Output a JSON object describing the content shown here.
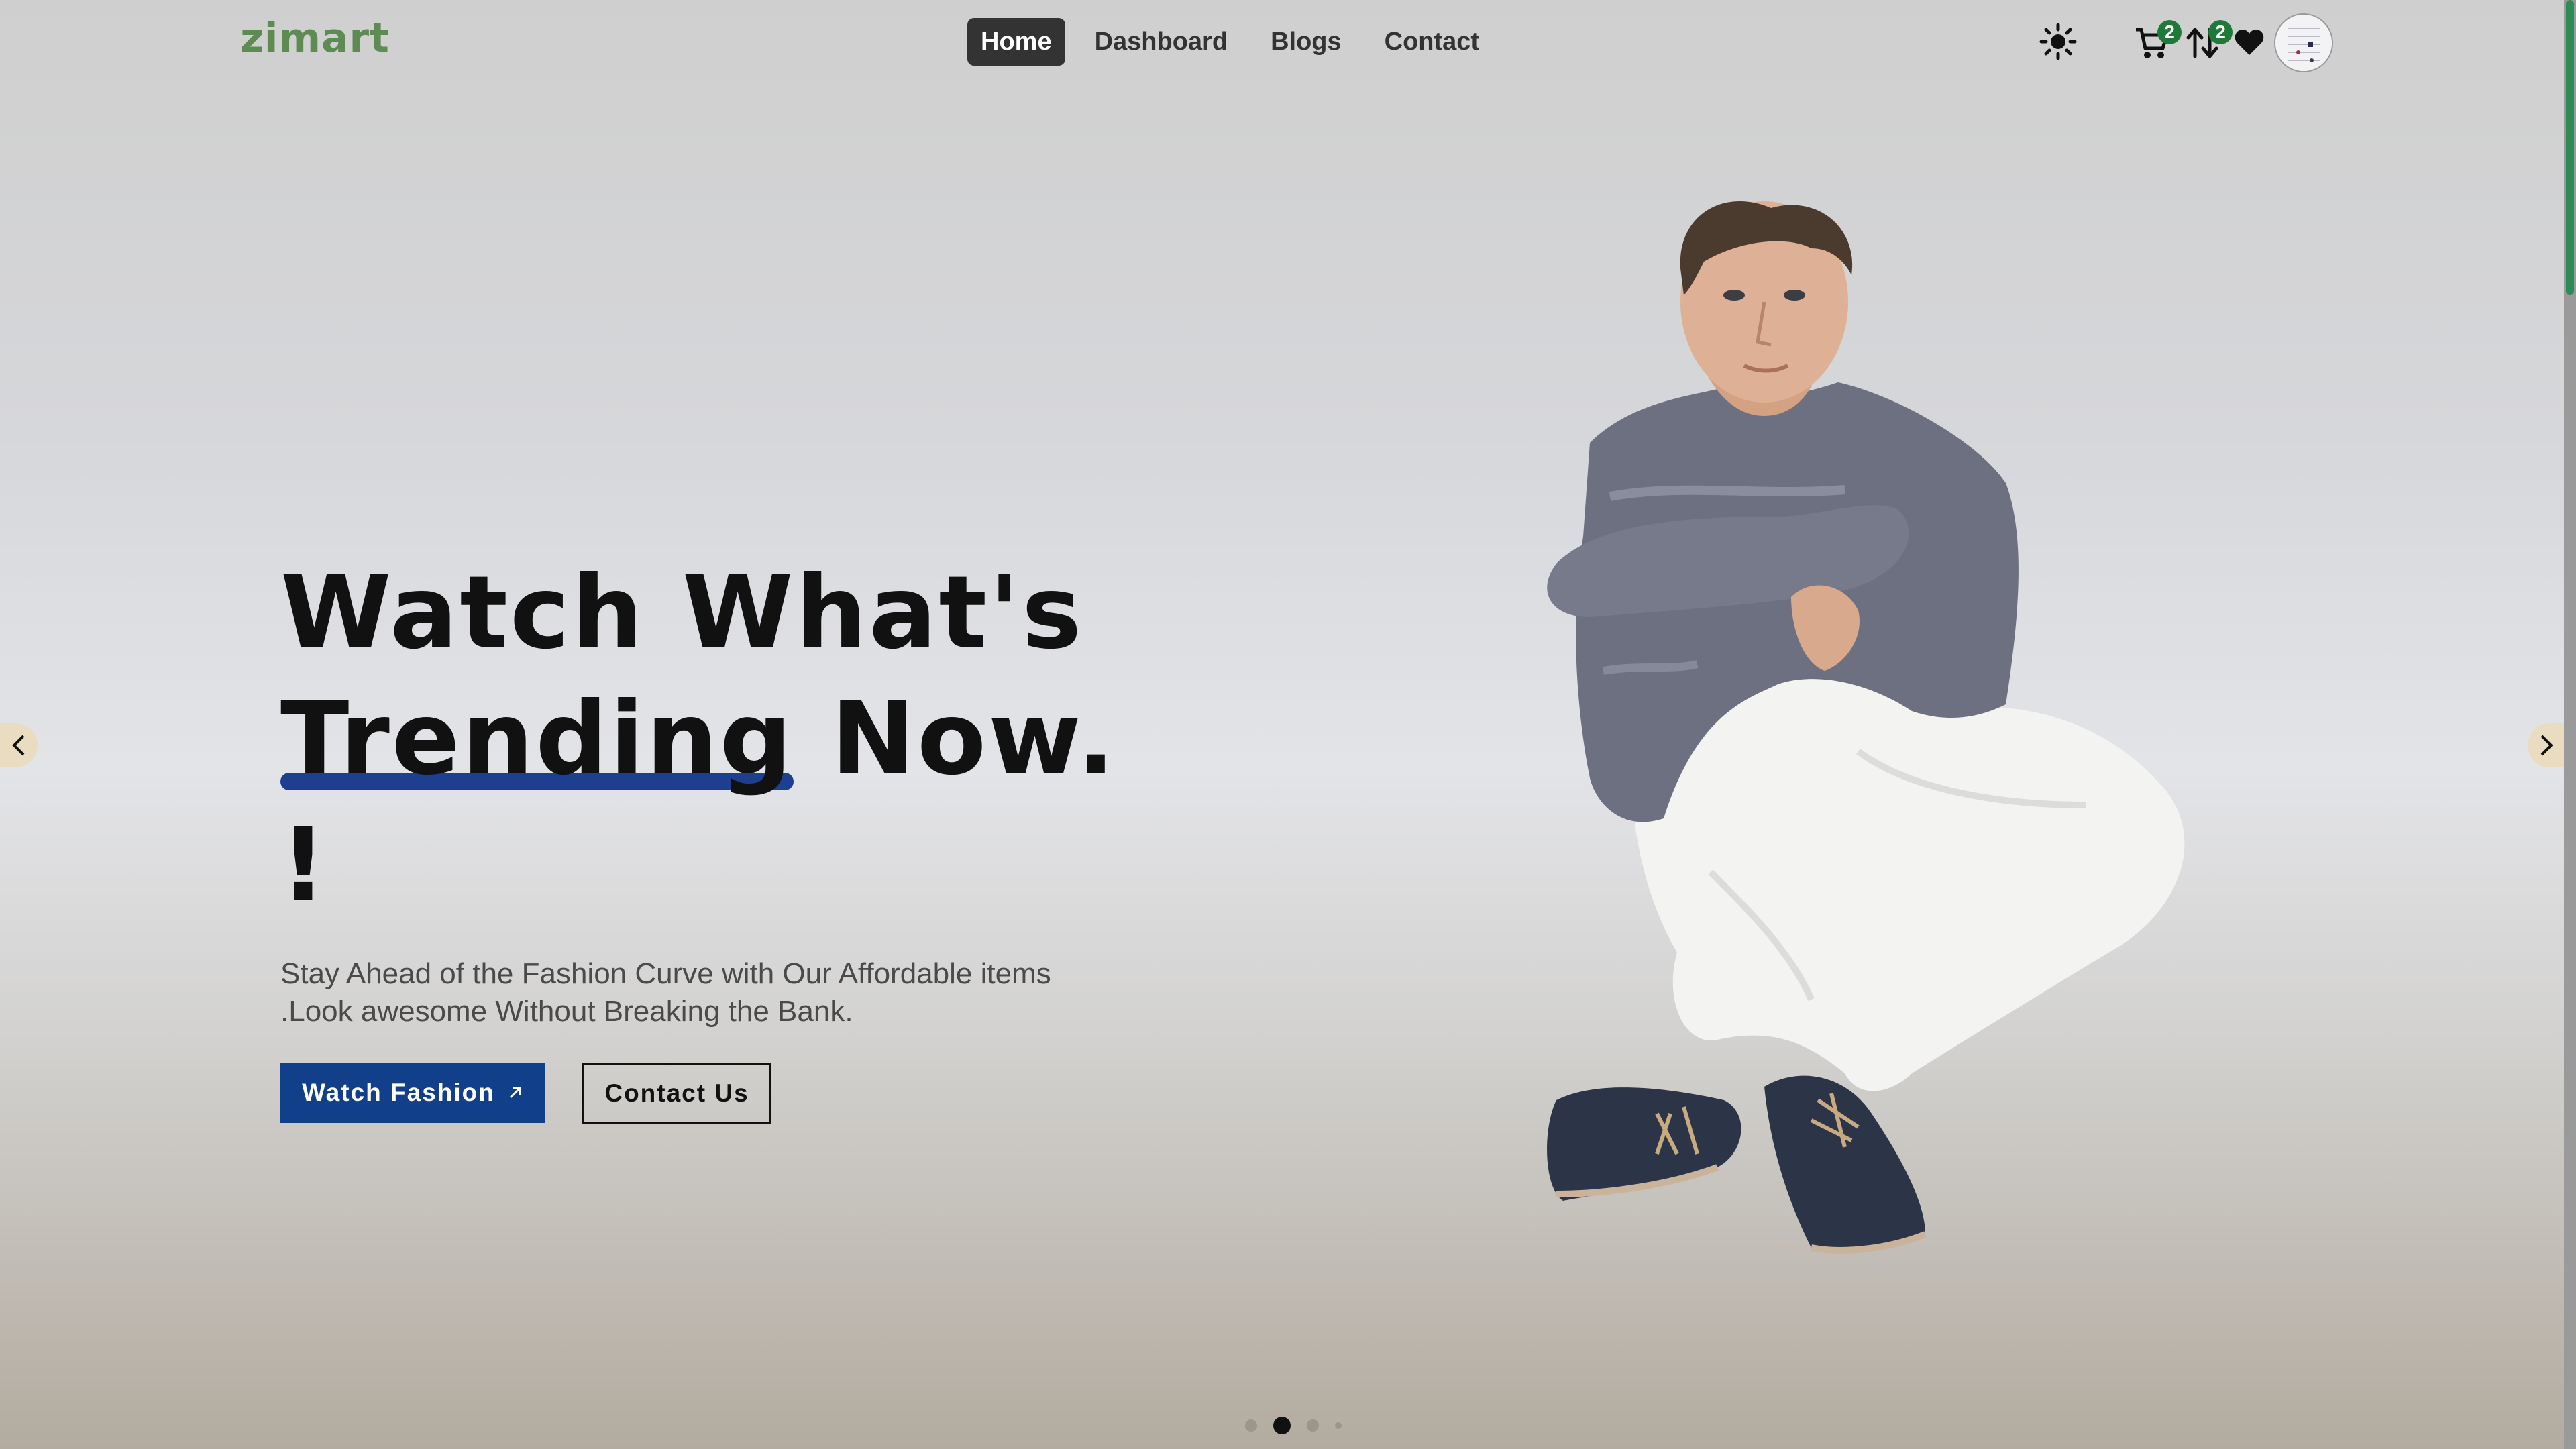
{
  "brand": {
    "logo_text": "zimart",
    "logo_color": "#5e8a53"
  },
  "nav": {
    "items": [
      {
        "label": "Home",
        "active": true
      },
      {
        "label": "Dashboard",
        "active": false
      },
      {
        "label": "Blogs",
        "active": false
      },
      {
        "label": "Contact",
        "active": false
      }
    ]
  },
  "header_icons": {
    "theme": "sun-icon",
    "cart": {
      "icon": "cart-icon",
      "badge": "2"
    },
    "compare": {
      "icon": "compare-icon",
      "badge": "2"
    },
    "wishlist": {
      "icon": "heart-icon"
    },
    "avatar": "user-avatar"
  },
  "hero": {
    "headline_line1": "Watch What's",
    "headline_highlight": "Trending",
    "headline_rest": "Now. !",
    "subtitle": "Stay Ahead of the Fashion Curve with Our Affordable items .Look awesome Without Breaking the Bank.",
    "primary_cta": "Watch Fashion",
    "secondary_cta": "Contact Us"
  },
  "carousel": {
    "slides": 4,
    "active_slide": 2
  },
  "colors": {
    "primary": "#123f8a",
    "highlight": "#1e3f8f",
    "badge": "#1f7a3a",
    "nav_active_bg": "#333333",
    "arrow_bg": "#e9dcc0"
  }
}
